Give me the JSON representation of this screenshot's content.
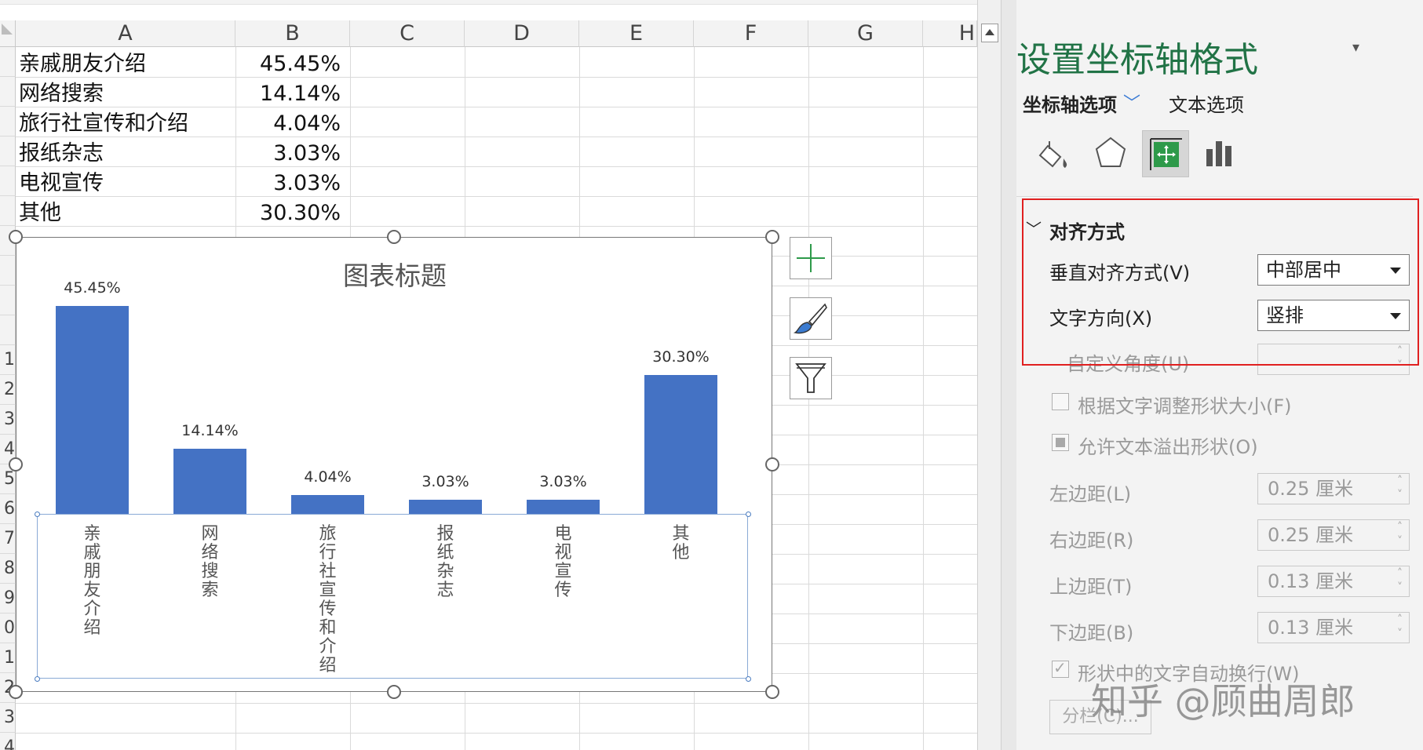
{
  "sheet": {
    "columns": [
      "A",
      "B",
      "C",
      "D",
      "E",
      "F",
      "G",
      "H"
    ],
    "row_numbers": [
      "0",
      "1",
      "2",
      "3",
      "4",
      "5",
      "6",
      "7",
      "8",
      "9",
      "0",
      "1",
      "2",
      "3",
      "4"
    ],
    "rows": [
      {
        "a": "亲戚朋友介绍",
        "b": "45.45%"
      },
      {
        "a": "网络搜索",
        "b": "14.14%"
      },
      {
        "a": "旅行社宣传和介绍",
        "b": "4.04%"
      },
      {
        "a": "报纸杂志",
        "b": "3.03%"
      },
      {
        "a": "电视宣传",
        "b": "3.03%"
      },
      {
        "a": "其他",
        "b": "30.30%"
      }
    ]
  },
  "chart_data": {
    "type": "bar",
    "title": "图表标题",
    "categories": [
      "亲戚朋友介绍",
      "网络搜索",
      "旅行社宣传和介绍",
      "报纸杂志",
      "电视宣传",
      "其他"
    ],
    "values": [
      45.45,
      14.14,
      4.04,
      3.03,
      3.03,
      30.3
    ],
    "data_labels": [
      "45.45%",
      "14.14%",
      "4.04%",
      "3.03%",
      "3.03%",
      "30.30%"
    ],
    "ylim": [
      0,
      50
    ],
    "bar_color": "#4472c4",
    "category_label_orientation": "vertical",
    "grid": false
  },
  "chart_buttons": [
    "chart-elements-plus-icon",
    "chart-styles-brush-icon",
    "chart-filter-funnel-icon"
  ],
  "panel": {
    "title": "设置坐标轴格式",
    "menu_glyph": "▾",
    "close_glyph": "×",
    "tab_axis": "坐标轴选项",
    "tab_axis_chevron": "﹀",
    "tab_text": "文本选项",
    "icons": [
      "fill-bucket-icon",
      "pentagon-effects-icon",
      "size-properties-icon",
      "bar-chart-icon"
    ],
    "section_chevron": "﹀",
    "section_title": "对齐方式",
    "vertical_align_label": "垂直对齐方式(V)",
    "vertical_align_value": "中部居中",
    "text_direction_label": "文字方向(X)",
    "text_direction_value": "竖排",
    "custom_angle_label": "自定义角度(U)",
    "resize_shape_label": "根据文字调整形状大小(F)",
    "overflow_label": "允许文本溢出形状(O)",
    "left_margin_label": "左边距(L)",
    "left_margin_value": "0.25 厘米",
    "right_margin_label": "右边距(R)",
    "right_margin_value": "0.25 厘米",
    "top_margin_label": "上边距(T)",
    "top_margin_value": "0.13 厘米",
    "bottom_margin_label": "下边距(B)",
    "bottom_margin_value": "0.13 厘米",
    "wrap_label": "形状中的文字自动换行(W)",
    "columns_button": "分栏(C)...",
    "spin_up": "˄",
    "spin_down": "˅"
  },
  "watermark": "知乎 @顾曲周郎",
  "colors": {
    "accent_green": "#217346",
    "highlight_red": "#e02020"
  }
}
